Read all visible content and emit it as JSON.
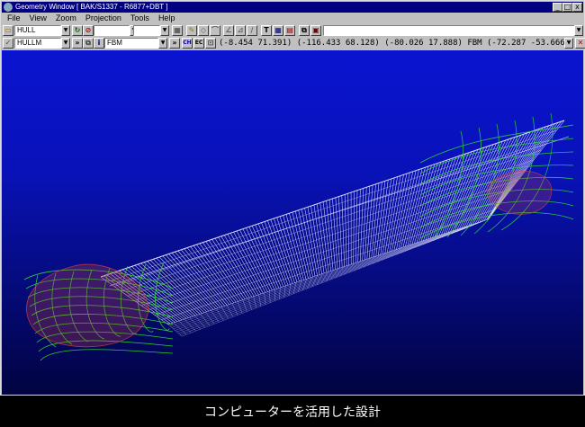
{
  "window": {
    "title": "Geometry Window [ BAK/S1337 - R6877+DBT ]",
    "buttons": [
      "_",
      "□",
      "x"
    ]
  },
  "menu": [
    {
      "label": "File"
    },
    {
      "label": "View"
    },
    {
      "label": "Zoom"
    },
    {
      "label": "Projection"
    },
    {
      "label": "Tools"
    },
    {
      "label": "Help"
    }
  ],
  "toolbar1": {
    "object_field": "HULL",
    "combo_a": "",
    "combo_b": "",
    "long_field": ""
  },
  "toolbar2": {
    "object_field": "HULLM",
    "layer_field": "FBM",
    "btn_ch": "CH",
    "btn_ec": "EC",
    "coordinates": "(-8.454 71.391) (-116.433 68.128) (-80.026 17.888) FBM (-72.287 -53.666)"
  },
  "caption": "コンピューターを活用した設計",
  "colors": {
    "title_bar": "#000080",
    "chrome": "#c0c0c0",
    "viewport_top": "#0a14d0",
    "viewport_bottom": "#020340",
    "wire_white": "#e8e8ff",
    "wire_green": "#30e030",
    "wire_red": "#d04040"
  }
}
